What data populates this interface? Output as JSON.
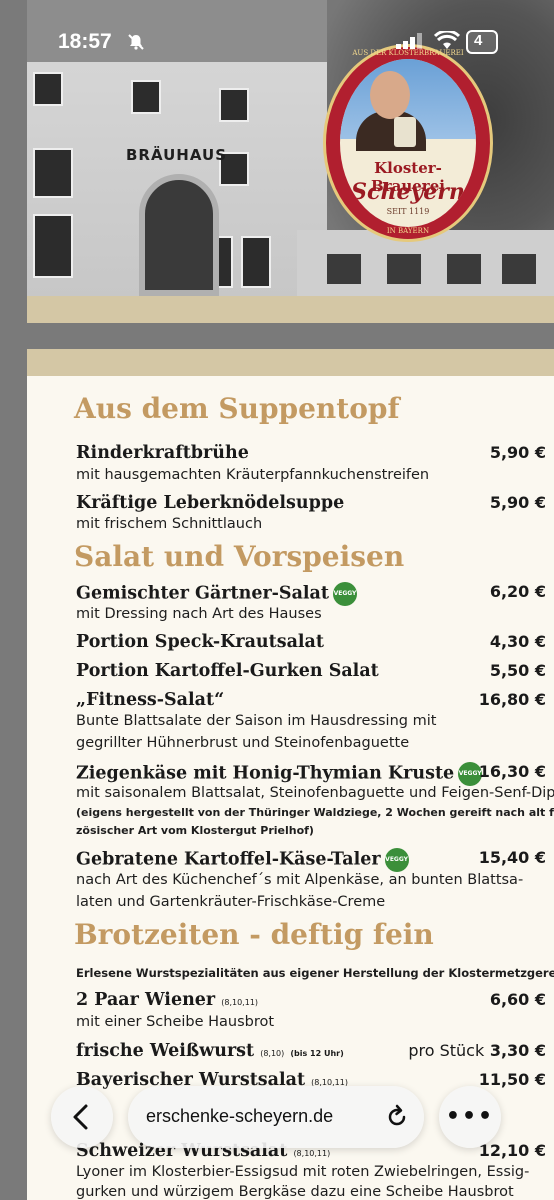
{
  "status_bar": {
    "time": "18:57",
    "battery": "4"
  },
  "header": {
    "building_sign": "BRÄUHAUS",
    "logo": {
      "ring_top": "AUS DER KLOSTERBRAUEREI",
      "line1": "Kloster-Brauerei",
      "line2": "Scheyern",
      "seit": "SEIT 1119",
      "ring_bottom": "IN BAYERN"
    }
  },
  "menu": {
    "section_soup": "Aus dem Suppentopf",
    "soup": [
      {
        "name": "Rinderkraftbrühe",
        "price": "5,90 €",
        "desc": "mit hausgemachten Kräuterpfannkuchenstreifen"
      },
      {
        "name": "Kräftige Leberknödelsuppe",
        "price": "5,90 €",
        "desc": "mit frischem Schnittlauch"
      }
    ],
    "section_salad": "Salat und Vorspeisen",
    "salad": [
      {
        "name": "Gemischter Gärtner-Salat",
        "price": "6,20 €",
        "desc": "mit Dressing nach Art des Hauses"
      },
      {
        "name": "Portion Speck-Krautsalat",
        "price": "4,30 €"
      },
      {
        "name": "Portion Kartoffel-Gurken Salat",
        "price": "5,50 €"
      },
      {
        "name": "„Fitness-Salat“",
        "price": "16,80 €",
        "desc": "Bunte Blattsalate der Saison im Hausdressing mit",
        "desc2": "gegrillter Hühnerbrust und Steinofenbaguette"
      },
      {
        "name": "Ziegenkäse mit Honig-Thymian Kruste",
        "price": "16,30 €",
        "desc": "mit saisonalem Blattsalat, Steinofenbaguette und Feigen-Senf-Dip",
        "note": "(eigens hergestellt von der Thüringer Waldziege, 2 Wochen gereift nach alt fran-",
        "note2": "zösischer Art vom Klostergut Prielhof)"
      },
      {
        "name": "Gebratene Kartoffel-Käse-Taler",
        "price": "15,40 €",
        "desc": "nach Art des Küchenchef´s mit Alpenkäse, an bunten Blattsa-",
        "desc2": "laten und Gartenkräuter-Frischkäse-Creme"
      }
    ],
    "veggy_badge": "VEGGY",
    "section_brotzeit": "Brotzeiten - deftig fein",
    "brotzeit_intro": "Erlesene Wurstspezialitäten aus eigener Herstellung der Klostermetzgerei",
    "brotzeit": [
      {
        "name": "2 Paar Wiener",
        "allergens": "(8,10,11)",
        "price": "6,60 €",
        "desc": "mit einer Scheibe Hausbrot"
      },
      {
        "name": "frische Weißwurst",
        "allergens": "(8,10)",
        "time_note": "(bis 12 Uhr)",
        "unit": "pro Stück",
        "price": "3,30 €"
      },
      {
        "name": "Bayerischer Wurstsalat",
        "allergens": "(8,10,11)",
        "price": "11,50 €"
      },
      {
        "name": "Schweizer Wurstsalat",
        "allergens": "(8,10,11)",
        "price": "12,10 €",
        "desc": "Lyoner im Klosterbier-Essigsud mit roten Zwiebelringen, Essig-",
        "desc2": "gurken und würzigem Bergkäse dazu eine Scheibe Hausbrot"
      }
    ]
  },
  "browser": {
    "url": "erschenke-scheyern.de"
  }
}
